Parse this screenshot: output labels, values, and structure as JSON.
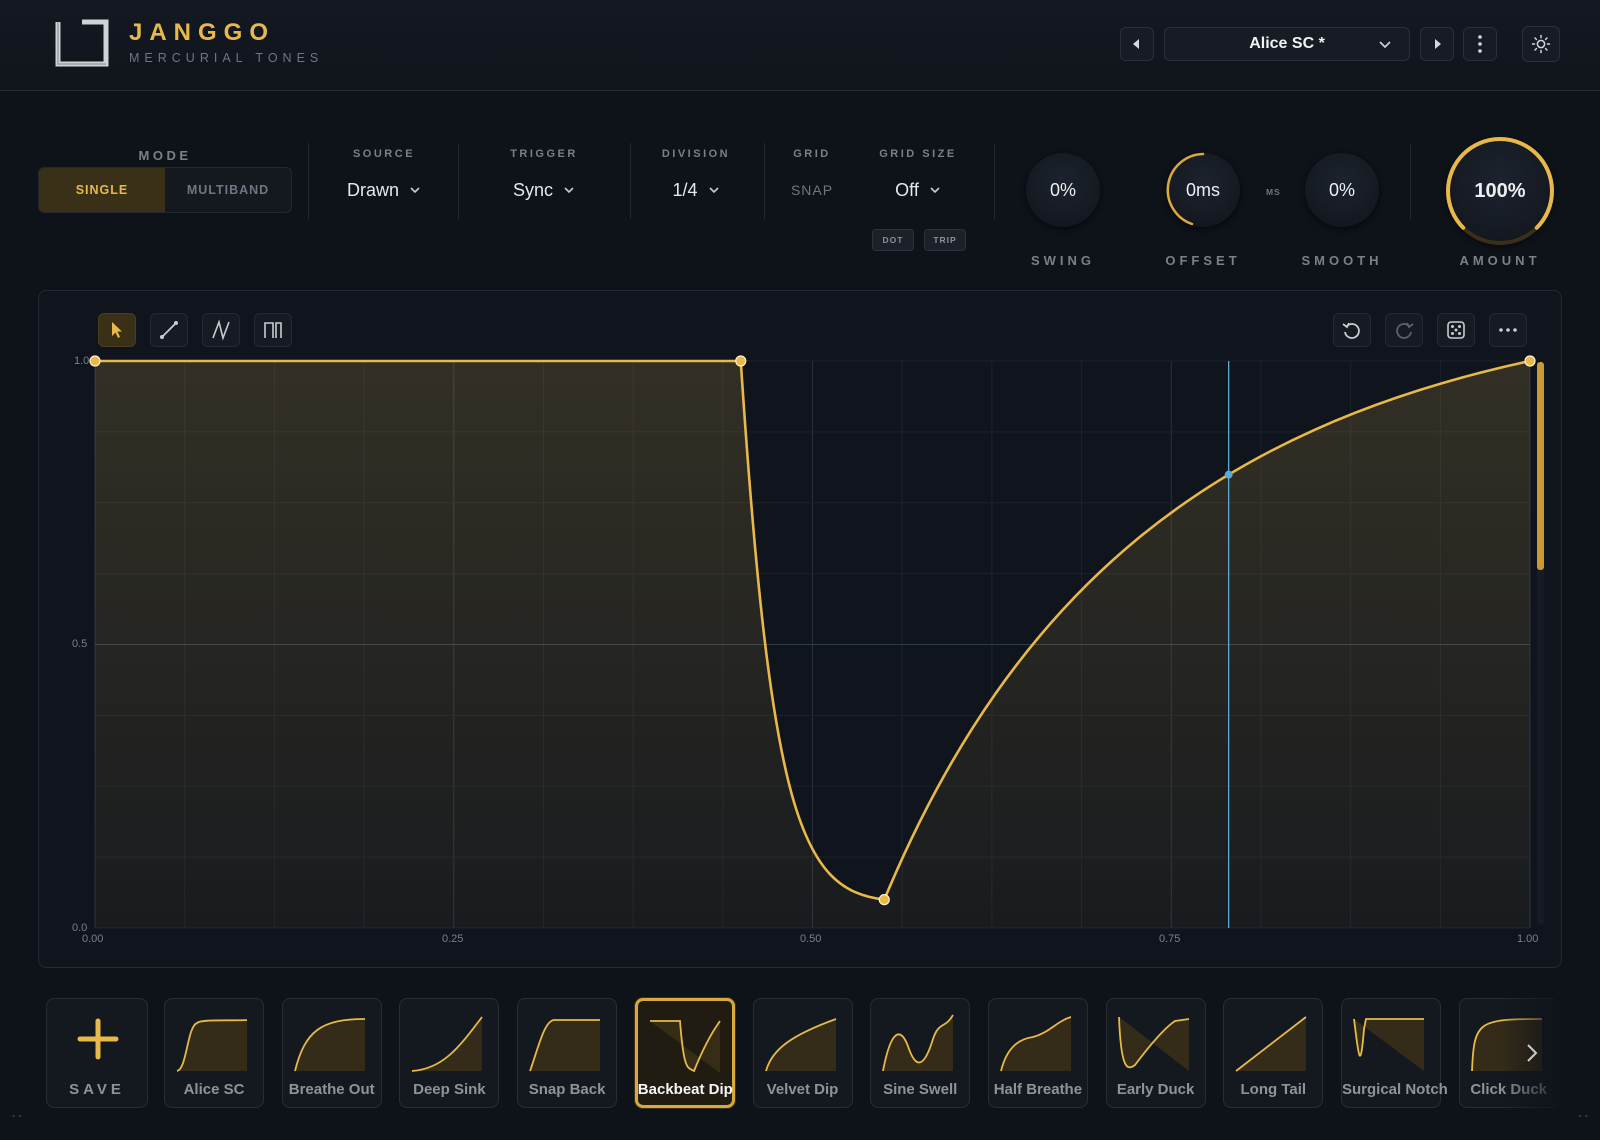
{
  "header": {
    "brand": "JANGGO",
    "brand_sub": "MERCURIAL TONES",
    "preset_name": "Alice SC *"
  },
  "controls": {
    "mode_label": "MODE",
    "mode_single": "SINGLE",
    "mode_multiband": "MULTIBAND",
    "source_label": "SOURCE",
    "source_value": "Drawn",
    "trigger_label": "TRIGGER",
    "trigger_value": "Sync",
    "division_label": "DIVISION",
    "division_value": "1/4",
    "grid_label": "GRID",
    "grid_value": "SNAP",
    "grid_size_label": "GRID SIZE",
    "grid_size_value": "Off",
    "dot_label": "DOT",
    "trip_label": "TRIP",
    "ms_label": "MS",
    "swing": {
      "label": "SWING",
      "value": "0%",
      "level": 0
    },
    "offset": {
      "label": "OFFSET",
      "value": "0ms",
      "level": 0
    },
    "smooth": {
      "label": "SMOOTH",
      "value": "0%",
      "level": 0
    },
    "amount": {
      "label": "AMOUNT",
      "value": "100%",
      "level": 1.0
    }
  },
  "graph": {
    "y_ticks": [
      "1.0",
      "0.5",
      "0.0"
    ],
    "x_ticks": [
      "0.00",
      "0.25",
      "0.50",
      "0.75",
      "1.00"
    ],
    "playhead_x": 0.79,
    "points": [
      [
        0.0,
        1.0
      ],
      [
        0.45,
        1.0
      ],
      [
        0.55,
        0.05
      ],
      [
        1.0,
        1.0
      ]
    ]
  },
  "presets": {
    "save_label": "SAVE",
    "items": [
      {
        "name": "Alice SC",
        "selected": false
      },
      {
        "name": "Breathe Out",
        "selected": false
      },
      {
        "name": "Deep Sink",
        "selected": false
      },
      {
        "name": "Snap Back",
        "selected": false
      },
      {
        "name": "Backbeat Dip",
        "selected": true
      },
      {
        "name": "Velvet Dip",
        "selected": false
      },
      {
        "name": "Sine Swell",
        "selected": false
      },
      {
        "name": "Half Breathe",
        "selected": false
      },
      {
        "name": "Early Duck",
        "selected": false
      },
      {
        "name": "Long Tail",
        "selected": false
      },
      {
        "name": "Surgical Notch",
        "selected": false
      },
      {
        "name": "Click Duck",
        "selected": false
      }
    ]
  },
  "colors": {
    "accent": "#e8b94a",
    "playhead": "#5aa9d6",
    "background": "#0e1219"
  }
}
